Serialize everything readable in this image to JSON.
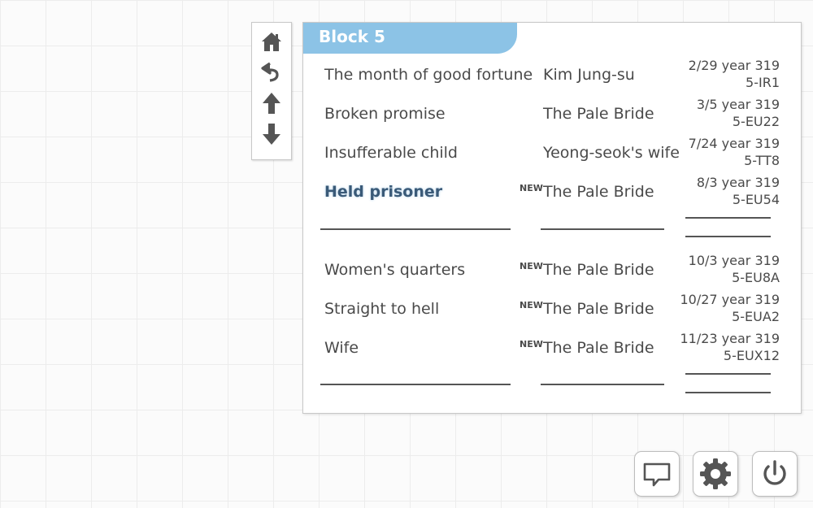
{
  "nav": {
    "home": "home-icon",
    "back": "undo-arrow-icon",
    "up": "arrow-up-icon",
    "down": "arrow-down-icon"
  },
  "block": {
    "title": "Block 5",
    "groups": [
      {
        "entries": [
          {
            "title": "The month of good fortune",
            "is_new": false,
            "new_label": "",
            "character": "Kim Jung-su",
            "date": "2/29 year 319",
            "code": "5-IR1",
            "selected": false
          },
          {
            "title": "Broken promise",
            "is_new": false,
            "new_label": "",
            "character": "The Pale Bride",
            "date": "3/5 year 319",
            "code": "5-EU22",
            "selected": false
          },
          {
            "title": "Insufferable child",
            "is_new": false,
            "new_label": "",
            "character": "Yeong-seok's wife",
            "date": "7/24 year 319",
            "code": "5-TT8",
            "selected": false
          },
          {
            "title": "Held prisoner",
            "is_new": true,
            "new_label": "NEW",
            "character": "The Pale Bride",
            "date": "8/3 year 319",
            "code": "5-EU54",
            "selected": true
          }
        ]
      },
      {
        "entries": [
          {
            "title": "Women's quarters",
            "is_new": true,
            "new_label": "NEW",
            "character": "The Pale Bride",
            "date": "10/3 year 319",
            "code": "5-EU8A",
            "selected": false
          },
          {
            "title": "Straight to hell",
            "is_new": true,
            "new_label": "NEW",
            "character": "The Pale Bride",
            "date": "10/27 year 319",
            "code": "5-EUA2",
            "selected": false
          },
          {
            "title": "Wife",
            "is_new": true,
            "new_label": "NEW",
            "character": "The Pale Bride",
            "date": "11/23 year 319",
            "code": "5-EUX12",
            "selected": false
          }
        ]
      }
    ]
  },
  "bottom": {
    "chat": "speech-bubble-icon",
    "settings": "gear-icon",
    "power": "power-icon"
  },
  "colors": {
    "accent": "#8cc3e6",
    "text": "#4a4a4a",
    "selected_text": "#3a5a78"
  }
}
